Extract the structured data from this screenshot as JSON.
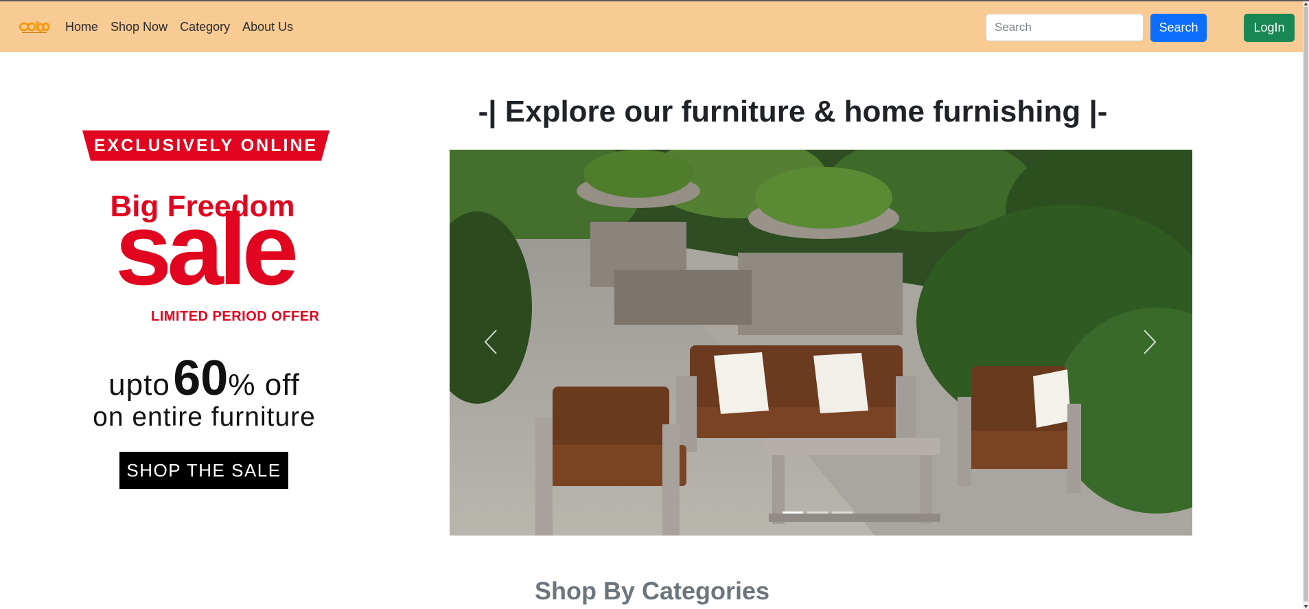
{
  "navbar": {
    "logo_icon": "cube-logo-icon",
    "links": [
      "Home",
      "Shop Now",
      "Category",
      "About Us"
    ],
    "search_placeholder": "Search",
    "search_button": "Search",
    "login_button": "LogIn",
    "colors": {
      "background": "#f8ca94",
      "search_btn": "#0d6efd",
      "login_btn": "#198754"
    }
  },
  "promo": {
    "banner": "EXCLUSIVELY ONLINE",
    "headline": "Big Freedom",
    "sale_word": "sale",
    "limited": "LIMITED PERIOD OFFER",
    "upto": "upto",
    "percent": "60",
    "off": "% off",
    "entire": "on entire furniture",
    "cta": "SHOP THE SALE",
    "accent_color": "#e1051f"
  },
  "hero": {
    "title": "-| Explore our furniture & home furnishing |-",
    "carousel": {
      "image_subject": "outdoor patio furniture with brown cushions and white pillows",
      "prev_icon": "chevron-left-icon",
      "next_icon": "chevron-right-icon",
      "slides": 3,
      "active_slide": 1
    }
  },
  "sections": {
    "categories_title": "Shop By Categories"
  }
}
